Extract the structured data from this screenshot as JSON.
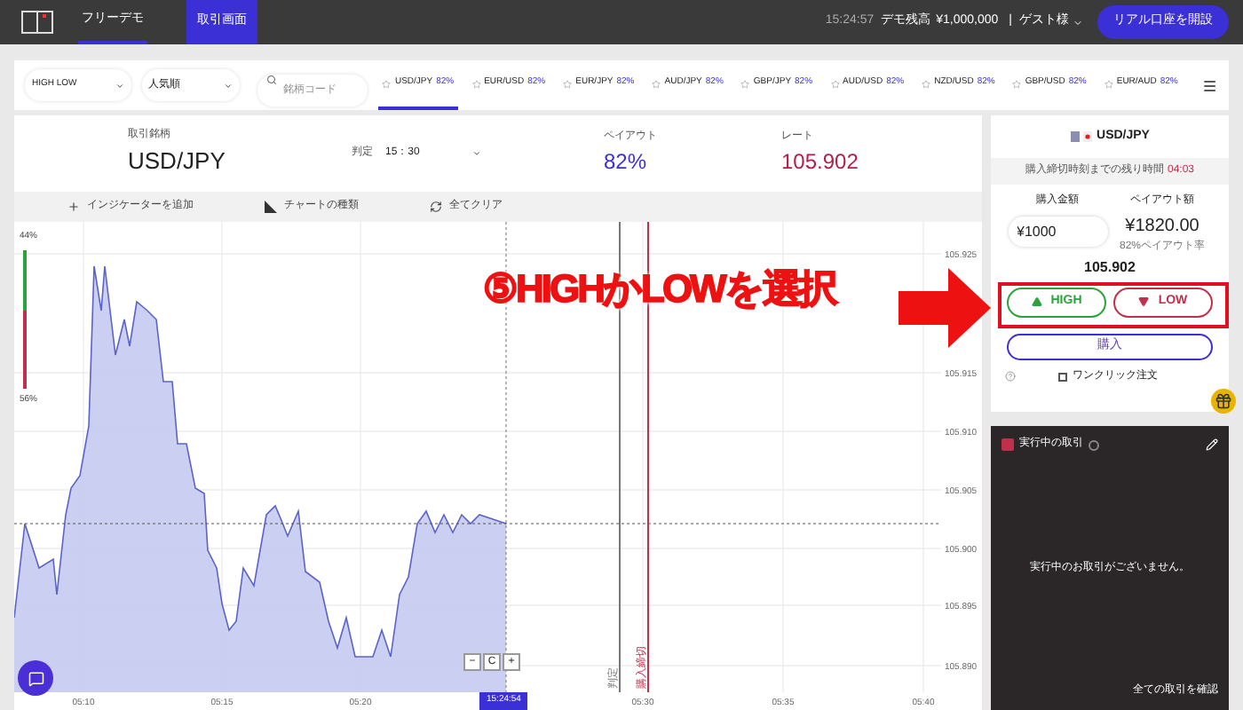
{
  "top_bar": {
    "brand": "フリーデモ",
    "tabs": [
      {
        "label": "取引画面",
        "selected": true
      }
    ],
    "clock": "15:24:57",
    "balance_label": "デモ残高",
    "balance": "¥1,000,000",
    "separator": "|",
    "user": "ゲスト様",
    "open_account": "リアル口座を開設"
  },
  "filters": {
    "type_select": "HIGH LOW",
    "sort_select": "人気順",
    "search": {
      "placeholder": "銘柄コード"
    }
  },
  "pairs": [
    {
      "name": "USD/JPY",
      "payout": "82%",
      "selected": true
    },
    {
      "name": "EUR/USD",
      "payout": "82%",
      "selected": false
    },
    {
      "name": "EUR/JPY",
      "payout": "82%",
      "selected": false
    },
    {
      "name": "AUD/JPY",
      "payout": "82%",
      "selected": false
    },
    {
      "name": "GBP/JPY",
      "payout": "82%",
      "selected": false
    },
    {
      "name": "AUD/USD",
      "payout": "82%",
      "selected": false
    },
    {
      "name": "NZD/USD",
      "payout": "82%",
      "selected": false
    },
    {
      "name": "GBP/USD",
      "payout": "82%",
      "selected": false
    },
    {
      "name": "EUR/AUD",
      "payout": "82%",
      "selected": false
    }
  ],
  "summary": {
    "symbol_label": "取引銘柄",
    "symbol": "USD/JPY",
    "expiry_label": "判定",
    "expiry": "15：30",
    "payout_label": "ペイアウト",
    "payout": "82%",
    "rate_label": "レート",
    "rate": "105.902"
  },
  "chart_tools": [
    {
      "kind": "plus",
      "label": "インジケーターを追加"
    },
    {
      "kind": "chart",
      "label": "チャートの種類"
    },
    {
      "kind": "refresh",
      "label": "全てクリア"
    }
  ],
  "sentiment": {
    "high": "44%",
    "low": "56%",
    "level": 0.44
  },
  "chart": {
    "now_label": "15:24:54",
    "zoom": [
      "−",
      "C",
      "+"
    ],
    "y_labels": [
      "105.925",
      "105.915",
      "105.910",
      "105.905",
      "105.900",
      "105.895",
      "105.890"
    ],
    "x_labels": [
      "05:10",
      "05:15",
      "05:20",
      "05:30",
      "05:35",
      "05:40"
    ],
    "markers": [
      {
        "label": "判定",
        "color": "#777777"
      },
      {
        "label": "購入締切",
        "color": "#c0304a"
      }
    ]
  },
  "order": {
    "symbol": "USD/JPY",
    "remaining_label": "購入締切時刻までの残り時間",
    "remaining": "04:03",
    "amount_label": "購入金額",
    "amount": "¥1000",
    "payout_label": "ペイアウト額",
    "payout": "¥1820.00",
    "payout_rate": "82%ペイアウト率",
    "rate": "105.902",
    "high": "HIGH",
    "low": "LOW",
    "buy": "購入",
    "one_click": {
      "label": "ワンクリック注文",
      "checked": false
    }
  },
  "positions": {
    "title": "実行中の取引",
    "empty": "実行中のお取引がございません。",
    "link": "全ての取引を確認"
  },
  "annotation": {
    "text": "⑤HIGHかLOWを選択"
  }
}
